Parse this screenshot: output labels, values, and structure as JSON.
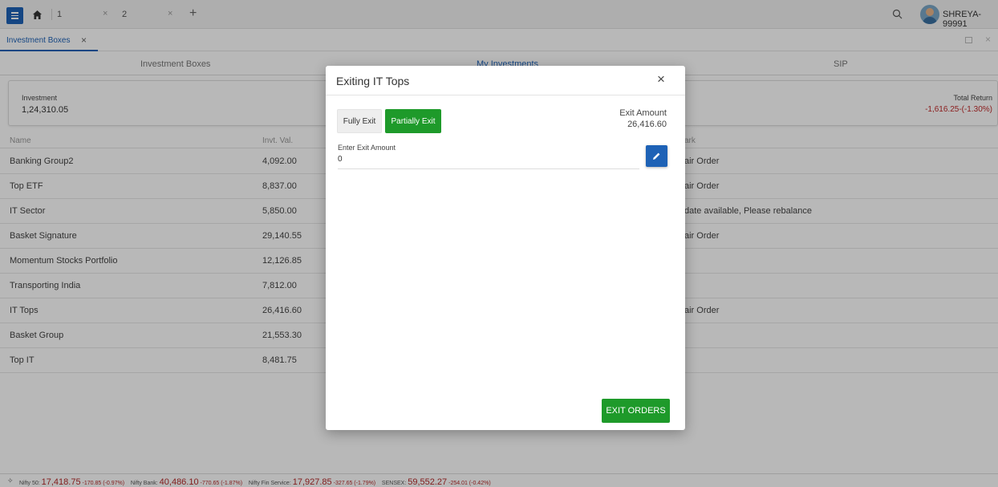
{
  "topbar": {
    "tab1_label": "1",
    "tab2_label": "2",
    "tab1_close": "×",
    "tab2_close": "×",
    "new_tab": "+",
    "username": "SHREYA-99991"
  },
  "subbar": {
    "tab_label": "Investment Boxes",
    "tab_close": "×",
    "window_close": "×"
  },
  "section_tabs": [
    "Investment Boxes",
    "My Investments",
    "SIP"
  ],
  "summary": {
    "investment_label": "Investment",
    "investment_value": "1,24,310.05",
    "total_return_label": "Total Return",
    "total_return_value": "-1,616.25-(-1.30%)"
  },
  "table": {
    "headers": {
      "name": "Name",
      "invt_val": "Invt. Val.",
      "remark": "ark"
    },
    "rows": [
      {
        "name": "Banking Group2",
        "value": "4,092.00",
        "remark": "air Order"
      },
      {
        "name": "Top ETF",
        "value": "8,837.00",
        "remark": "air Order"
      },
      {
        "name": "IT Sector",
        "value": "5,850.00",
        "remark": "date available, Please rebalance"
      },
      {
        "name": "Basket Signature",
        "value": "29,140.55",
        "remark": "air Order"
      },
      {
        "name": "Momentum Stocks Portfolio",
        "value": "12,126.85",
        "remark": ""
      },
      {
        "name": "Transporting India",
        "value": "7,812.00",
        "remark": ""
      },
      {
        "name": "IT Tops",
        "value": "26,416.60",
        "remark": "air Order"
      },
      {
        "name": "Basket Group",
        "value": "21,553.30",
        "remark": ""
      },
      {
        "name": "Top IT",
        "value": "8,481.75",
        "remark": ""
      }
    ]
  },
  "modal": {
    "title": "Exiting IT Tops",
    "close": "×",
    "fully_exit_label": "Fully Exit",
    "partially_exit_label": "Partially Exit",
    "exit_amount_label": "Exit Amount",
    "exit_amount_value": "26,416.60",
    "input_label": "Enter Exit Amount",
    "input_value": "0",
    "exit_orders_label": "EXIT ORDERS"
  },
  "footer": {
    "nifty50_label": "Nifty 50:",
    "nifty50_value": "17,418.75",
    "nifty50_change": "-170.85 (-0.97%)",
    "niftybank_label": "Nifty Bank:",
    "niftybank_value": "40,486.10",
    "niftybank_change": "-770.65 (-1.87%)",
    "niftyfin_label": "Nifty Fin Service:",
    "niftyfin_value": "17,927.85",
    "niftyfin_change": "-327.65 (-1.79%)",
    "sensex_label": "SENSEX:",
    "sensex_value": "59,552.27",
    "sensex_change": "-254.01 (-0.42%)"
  },
  "colors": {
    "brand_blue": "#1e62b6",
    "action_green": "#1e9a2a",
    "negative_red": "#c12a2a"
  }
}
